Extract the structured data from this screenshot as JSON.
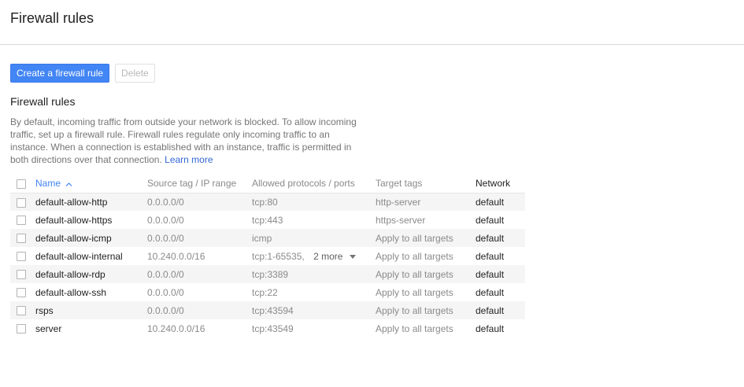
{
  "header": {
    "title": "Firewall rules"
  },
  "toolbar": {
    "create_label": "Create a firewall rule",
    "delete_label": "Delete"
  },
  "section": {
    "title": "Firewall rules",
    "description": "By default, incoming traffic from outside your network is blocked. To allow incoming traffic, set up a firewall rule. Firewall rules regulate only incoming traffic to an instance. When a connection is established with an instance, traffic is permitted in both directions over that connection.",
    "learn_more": "Learn more"
  },
  "table": {
    "columns": {
      "name": "Name",
      "source": "Source tag / IP range",
      "protocols": "Allowed protocols / ports",
      "tags": "Target tags",
      "network": "Network"
    },
    "rows": [
      {
        "name": "default-allow-http",
        "source": "0.0.0.0/0",
        "protocols": "tcp:80",
        "tags": "http-server",
        "network": "default"
      },
      {
        "name": "default-allow-https",
        "source": "0.0.0.0/0",
        "protocols": "tcp:443",
        "tags": "https-server",
        "network": "default"
      },
      {
        "name": "default-allow-icmp",
        "source": "0.0.0.0/0",
        "protocols": "icmp",
        "tags": "Apply to all targets",
        "network": "default"
      },
      {
        "name": "default-allow-internal",
        "source": "10.240.0.0/16",
        "protocols": "tcp:1-65535,",
        "more": "2 more",
        "tags": "Apply to all targets",
        "network": "default"
      },
      {
        "name": "default-allow-rdp",
        "source": "0.0.0.0/0",
        "protocols": "tcp:3389",
        "tags": "Apply to all targets",
        "network": "default"
      },
      {
        "name": "default-allow-ssh",
        "source": "0.0.0.0/0",
        "protocols": "tcp:22",
        "tags": "Apply to all targets",
        "network": "default"
      },
      {
        "name": "rsps",
        "source": "0.0.0.0/0",
        "protocols": "tcp:43594",
        "tags": "Apply to all targets",
        "network": "default"
      },
      {
        "name": "server",
        "source": "10.240.0.0/16",
        "protocols": "tcp:43549",
        "tags": "Apply to all targets",
        "network": "default"
      }
    ]
  },
  "icons": {
    "sort": "sort-ascending-icon",
    "more_caret": "caret-down-icon"
  },
  "colors": {
    "primary": "#4285f4",
    "link": "#3367d6",
    "row_stripe": "#f5f5f5"
  }
}
